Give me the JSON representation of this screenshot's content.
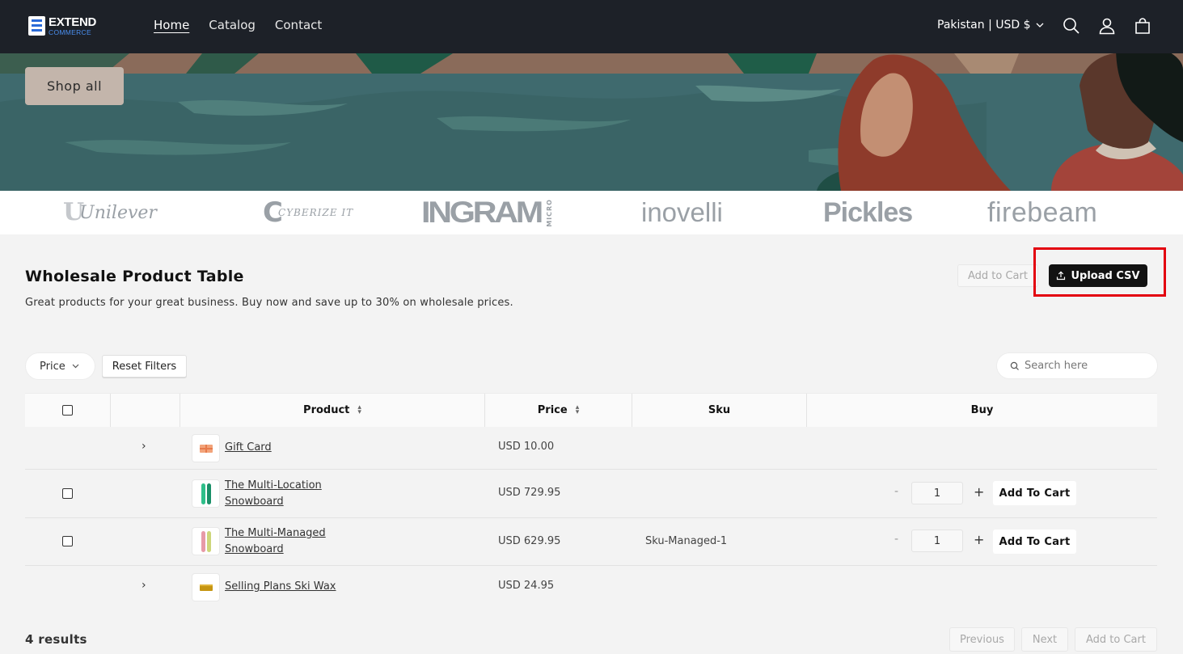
{
  "header": {
    "logo_line1": "EXTEND",
    "logo_line2": "COMMERCE",
    "nav": [
      {
        "label": "Home",
        "active": true
      },
      {
        "label": "Catalog"
      },
      {
        "label": "Contact"
      }
    ],
    "locale": "Pakistan | USD $",
    "icons": [
      "search-icon",
      "account-icon",
      "cart-icon"
    ]
  },
  "hero": {
    "button_label": "Shop all"
  },
  "brands": [
    "Unilever",
    "CYBERIZE IT",
    "INGRAM",
    "MICRO",
    "inovelli",
    "Pickles",
    "firebeam"
  ],
  "section": {
    "title": "Wholesale Product Table",
    "subtitle": "Great products for your great business. Buy now and save up to 30% on wholesale prices.",
    "add_to_cart_label": "Add to Cart",
    "upload_label": "Upload CSV"
  },
  "filters": {
    "price_label": "Price",
    "reset_label": "Reset Filters",
    "search_placeholder": "Search here"
  },
  "table": {
    "columns": [
      "Product",
      "Price",
      "Sku",
      "Buy"
    ],
    "rows": [
      {
        "name": "Gift Card",
        "price": "USD 10.00",
        "sku": "",
        "expandable": true
      },
      {
        "name_line1": "The Multi-Location",
        "name_line2": "Snowboard",
        "price": "USD 729.95",
        "sku": "",
        "qty": "1",
        "minus": "-",
        "plus": "+",
        "button": "Add To Cart"
      },
      {
        "name_line1": "The Multi-Managed",
        "name_line2": "Snowboard",
        "price": "USD 629.95",
        "sku": "Sku-Managed-1",
        "qty": "1",
        "minus": "-",
        "plus": "+",
        "button": "Add To Cart"
      },
      {
        "name": "Selling Plans Ski Wax",
        "price": "USD 24.95",
        "sku": "",
        "expandable": true
      }
    ]
  },
  "footer": {
    "results": "4 results",
    "previous": "Previous",
    "next": "Next",
    "add_to_cart": "Add to Cart"
  },
  "colors": {
    "header_bg": "#1d2128",
    "highlight": "#e3000f",
    "primary_button": "#121212"
  }
}
